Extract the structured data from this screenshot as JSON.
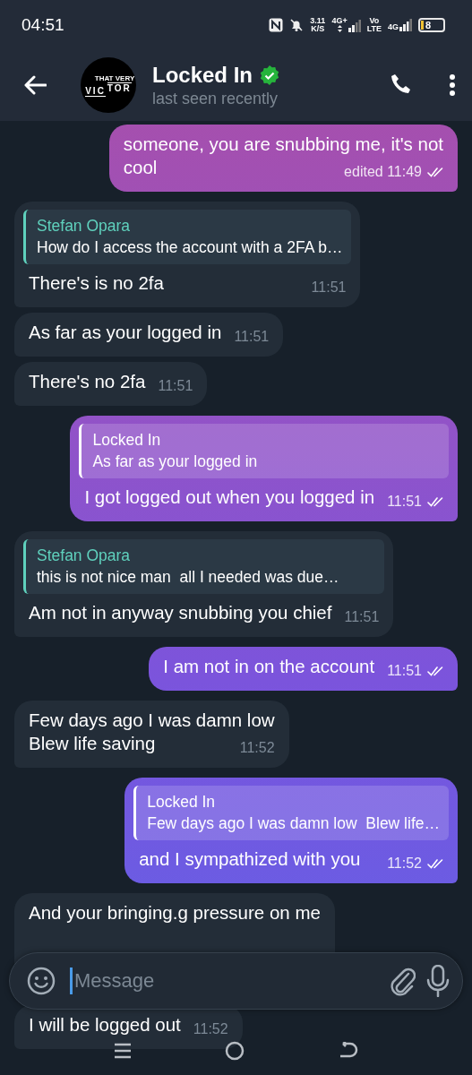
{
  "status_bar": {
    "time": "04:51",
    "speed": "3.11",
    "speed_unit": "K/S",
    "network_primary": "4G+",
    "volte_top": "Vo",
    "volte_bottom": "LTE",
    "network_secondary": "4G",
    "battery": "8"
  },
  "header": {
    "title": "Locked In",
    "verified": true,
    "subtitle": "last seen recently",
    "avatar": {
      "tagline": "THAT VERY",
      "left": "VIC",
      "right": "TOR"
    }
  },
  "messages": [
    {
      "kind": "out",
      "text": "someone, you are snubbing me, it's not\ncool",
      "time": "edited 11:49",
      "read": true
    },
    {
      "kind": "in",
      "reply": {
        "author": "Stefan Opara",
        "text": "How do I access the account with a 2FA b…"
      },
      "text": "There's is no 2fa",
      "time": "11:51"
    },
    {
      "kind": "in",
      "text": "As far as your logged in",
      "time": "11:51"
    },
    {
      "kind": "in",
      "text": "There's no 2fa",
      "time": "11:51"
    },
    {
      "kind": "out",
      "reply": {
        "author": "Locked In",
        "text": "As far as your logged in"
      },
      "text": "I got logged out when you logged in",
      "time": "11:51",
      "read": true
    },
    {
      "kind": "in",
      "reply": {
        "author": "Stefan Opara",
        "text": "this is not nice man  all I needed was due…"
      },
      "text": "Am not in anyway snubbing you chief",
      "time": "11:51"
    },
    {
      "kind": "out",
      "text": "I am not in on the account",
      "time": "11:51",
      "read": true
    },
    {
      "kind": "in",
      "text": "Few days ago I was damn low\nBlew life saving",
      "time": "11:52"
    },
    {
      "kind": "out",
      "reply": {
        "author": "Locked In",
        "text": "Few days ago I was damn low  Blew life…"
      },
      "text": "and I sympathized with you",
      "time": "11:52",
      "read": true
    },
    {
      "kind": "in",
      "text": "And your bringing.g pressure on me"
    },
    {
      "kind": "in",
      "text": "I will be logged out",
      "time": "11:52"
    }
  ],
  "composer": {
    "placeholder": "Message"
  }
}
